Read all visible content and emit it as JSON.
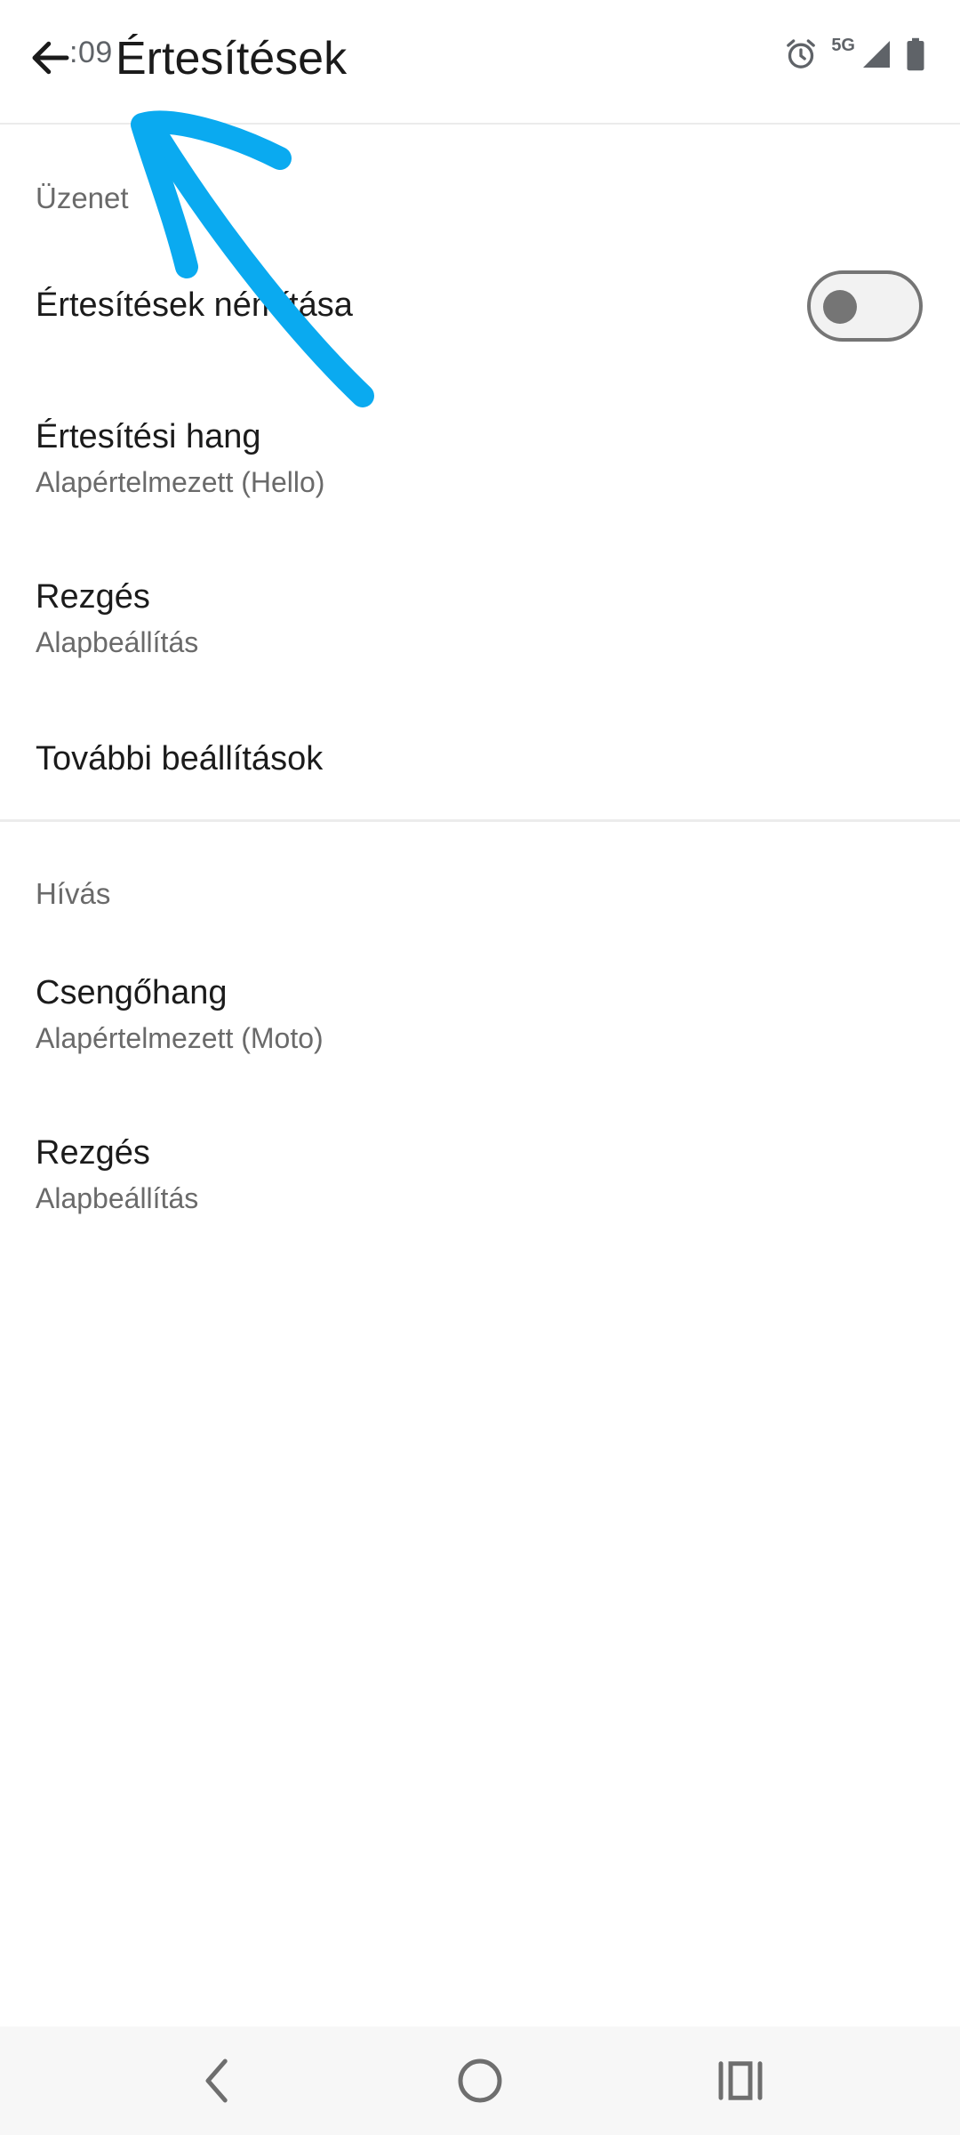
{
  "status_bar": {
    "time": ":09",
    "network_label": "5G",
    "icons": [
      "alarm-icon",
      "signal-icon",
      "battery-icon"
    ]
  },
  "app_bar": {
    "title": "Értesítések",
    "back_icon": "arrow-left-icon"
  },
  "sections": [
    {
      "header": "Üzenet",
      "items": [
        {
          "title": "Értesítések némítása",
          "toggle_on": false
        },
        {
          "title": "Értesítési hang",
          "subtitle": "Alapértelmezett (Hello)"
        },
        {
          "title": "Rezgés",
          "subtitle": "Alapbeállítás"
        },
        {
          "title": "További beállítások"
        }
      ]
    },
    {
      "header": "Hívás",
      "items": [
        {
          "title": "Csengőhang",
          "subtitle": "Alapértelmezett (Moto)"
        },
        {
          "title": "Rezgés",
          "subtitle": "Alapbeállítás"
        }
      ]
    }
  ],
  "annotation": {
    "color": "#0aaaf0",
    "shape": "arrow-icon"
  },
  "nav_bar": {
    "buttons": [
      "nav-back-icon",
      "nav-home-icon",
      "nav-recents-icon"
    ]
  },
  "colors": {
    "text_primary": "#1b1b1b",
    "text_secondary": "#6a6a6a",
    "toggle_off": "#757575",
    "divider": "#ececec"
  }
}
